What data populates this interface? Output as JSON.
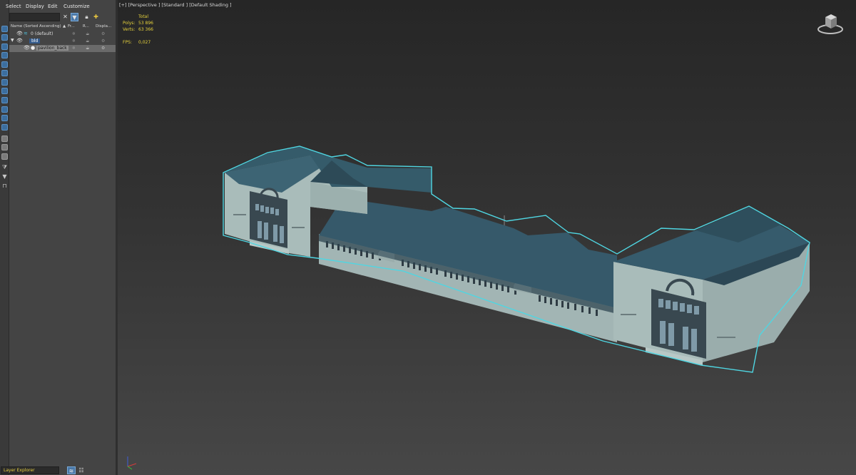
{
  "menu": {
    "select": "Select",
    "display": "Display",
    "edit": "Edit",
    "customize": "Customize"
  },
  "toolbar": {
    "search_value": "",
    "icons": [
      "close-icon",
      "filter-icon",
      "lock-icon",
      "add-layer-icon"
    ]
  },
  "columns": {
    "name": "Name (Sorted Ascending)",
    "sort_arrow": "▲",
    "frozen": "Fr...",
    "render": "R...",
    "display": "Displa..."
  },
  "tree": [
    {
      "label": "0 (default)",
      "level": 0
    },
    {
      "label": "bld",
      "level": 0
    },
    {
      "label": "pavilion_back",
      "level": 1
    }
  ],
  "viewport": {
    "label": "[+] [Perspective ] [Standard ] [Default Shading ]",
    "stats": {
      "total_label": "Total",
      "polys_label": "Polys:",
      "polys_value": "53 896",
      "verts_label": "Verts:",
      "verts_value": "63 366",
      "fps_label": "FPS:",
      "fps_value": "0,027"
    }
  },
  "bottom": {
    "layer_explorer": "Layer Explorer"
  },
  "colors": {
    "selection_outline": "#4fd6e2",
    "roof": "#345866",
    "wall": "#a9bcba",
    "stats_text": "#e6d23c",
    "accent": "#4a78a8"
  }
}
